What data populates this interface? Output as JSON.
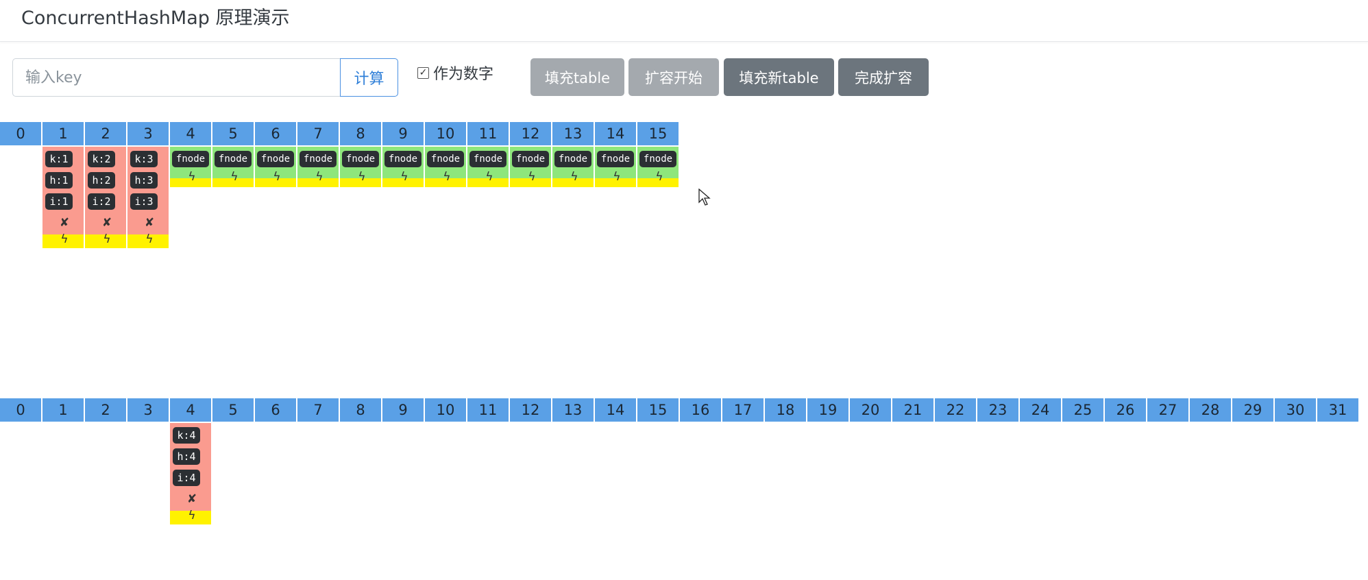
{
  "header": {
    "title": "ConcurrentHashMap 原理演示"
  },
  "controls": {
    "key_placeholder": "输入key",
    "calc_label": "计算",
    "as_number_label": "作为数字",
    "as_number_checked": true,
    "fill_table_label": "填充table",
    "resize_start_label": "扩容开始",
    "fill_new_table_label": "填充新table",
    "finish_resize_label": "完成扩容"
  },
  "icons": {
    "checkbox": "checkbox-checked-icon",
    "node_marker": "cross-icon",
    "lock": "lightning-icon",
    "cursor": "mouse-pointer-icon"
  },
  "colors": {
    "index_header": "#5aa0e6",
    "node_bucket": "#fa9b8f",
    "forwarding_bucket": "#8ee67c",
    "lock_bar": "#fff200",
    "tag_bg": "#2b2f33"
  },
  "old_table": {
    "indices": [
      "0",
      "1",
      "2",
      "3",
      "4",
      "5",
      "6",
      "7",
      "8",
      "9",
      "10",
      "11",
      "12",
      "13",
      "14",
      "15"
    ],
    "nodes": [
      {
        "bucket": 1,
        "k": "k:1",
        "h": "h:1",
        "i": "i:1"
      },
      {
        "bucket": 2,
        "k": "k:2",
        "h": "h:2",
        "i": "i:2"
      },
      {
        "bucket": 3,
        "k": "k:3",
        "h": "h:3",
        "i": "i:3"
      }
    ],
    "forwarding_label": "fnode",
    "forwarding_buckets": [
      4,
      5,
      6,
      7,
      8,
      9,
      10,
      11,
      12,
      13,
      14,
      15
    ]
  },
  "new_table": {
    "indices": [
      "0",
      "1",
      "2",
      "3",
      "4",
      "5",
      "6",
      "7",
      "8",
      "9",
      "10",
      "11",
      "12",
      "13",
      "14",
      "15",
      "16",
      "17",
      "18",
      "19",
      "20",
      "21",
      "22",
      "23",
      "24",
      "25",
      "26",
      "27",
      "28",
      "29",
      "30",
      "31"
    ],
    "nodes": [
      {
        "bucket": 4,
        "k": "k:4",
        "h": "h:4",
        "i": "i:4"
      }
    ]
  }
}
